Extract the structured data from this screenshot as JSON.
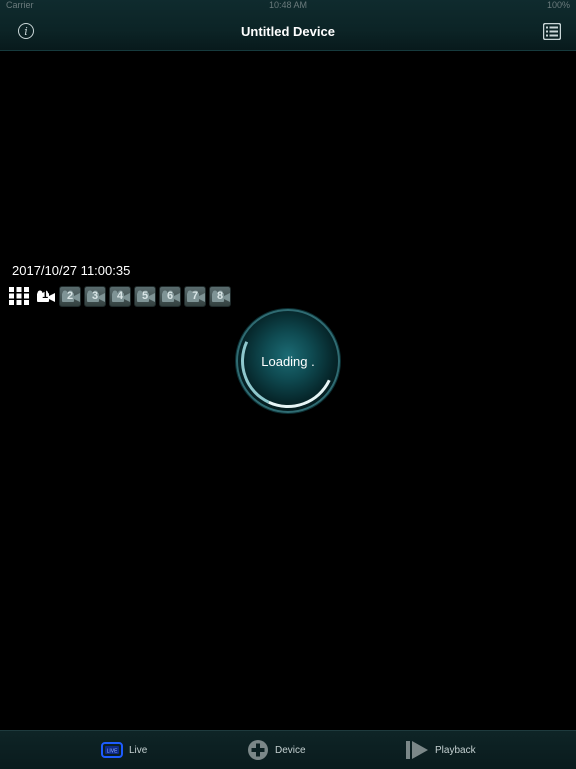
{
  "status_bar": {
    "left": "Carrier",
    "time": "10:48 AM",
    "right": "100%"
  },
  "nav": {
    "title": "Untitled Device",
    "info_icon": "info-icon",
    "list_icon": "list-icon"
  },
  "viewer": {
    "datetime": "2017/10/27 11:00:35",
    "channels": [
      {
        "label": "1",
        "active": true
      },
      {
        "label": "2",
        "active": false
      },
      {
        "label": "3",
        "active": false
      },
      {
        "label": "4",
        "active": false
      },
      {
        "label": "5",
        "active": false
      },
      {
        "label": "6",
        "active": false
      },
      {
        "label": "7",
        "active": false
      },
      {
        "label": "8",
        "active": false
      }
    ],
    "loading_text": "Loading ."
  },
  "tabs": [
    {
      "label": "Live",
      "icon": "live-tv-icon",
      "accent": "#1e5cff"
    },
    {
      "label": "Device",
      "icon": "add-circle-icon"
    },
    {
      "label": "Playback",
      "icon": "playback-icon"
    }
  ]
}
